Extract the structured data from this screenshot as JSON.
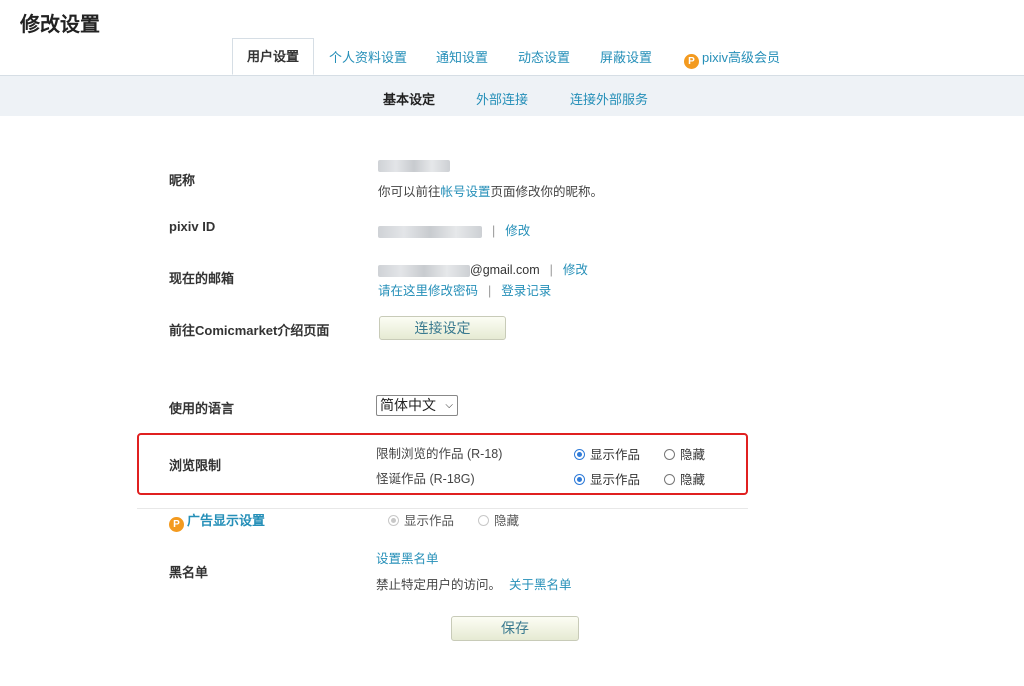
{
  "page_title": "修改设置",
  "tabs": [
    {
      "label": "用户设置"
    },
    {
      "label": "个人资料设置"
    },
    {
      "label": "通知设置"
    },
    {
      "label": "动态设置"
    },
    {
      "label": "屏蔽设置"
    },
    {
      "label": "pixiv高级会员"
    }
  ],
  "subnav": [
    "基本设定",
    "外部连接",
    "连接外部服务"
  ],
  "nickname": {
    "label": "昵称",
    "hint_prefix": "你可以前往",
    "hint_link": "帐号设置",
    "hint_suffix": "页面修改你的昵称。"
  },
  "pixiv_id": {
    "label": "pixiv ID",
    "change": "修改"
  },
  "email": {
    "label": "现在的邮箱",
    "value_suffix": "@gmail.com",
    "change": "修改",
    "password_link": "请在这里修改密码",
    "login_log": "登录记录"
  },
  "comicmarket": {
    "label": "前往Comicmarket介绍页面",
    "button": "连接设定"
  },
  "language": {
    "label": "使用的语言",
    "selected": "简体中文"
  },
  "browse_limit": {
    "label": "浏览限制",
    "rows": [
      {
        "name": "限制浏览的作品 (R-18)",
        "show": "显示作品",
        "hide": "隐藏"
      },
      {
        "name": "怪诞作品 (R-18G)",
        "show": "显示作品",
        "hide": "隐藏"
      }
    ]
  },
  "ads": {
    "label": "广告显示设置",
    "show": "显示作品",
    "hide": "隐藏"
  },
  "blacklist": {
    "label": "黑名单",
    "set_link": "设置黑名单",
    "desc": "禁止特定用户的访问。",
    "about_link": "关于黑名单"
  },
  "save_button": "保存",
  "colors": {
    "link": "#258fb8",
    "highlight": "#e02020",
    "premium": "#f39a1f"
  }
}
